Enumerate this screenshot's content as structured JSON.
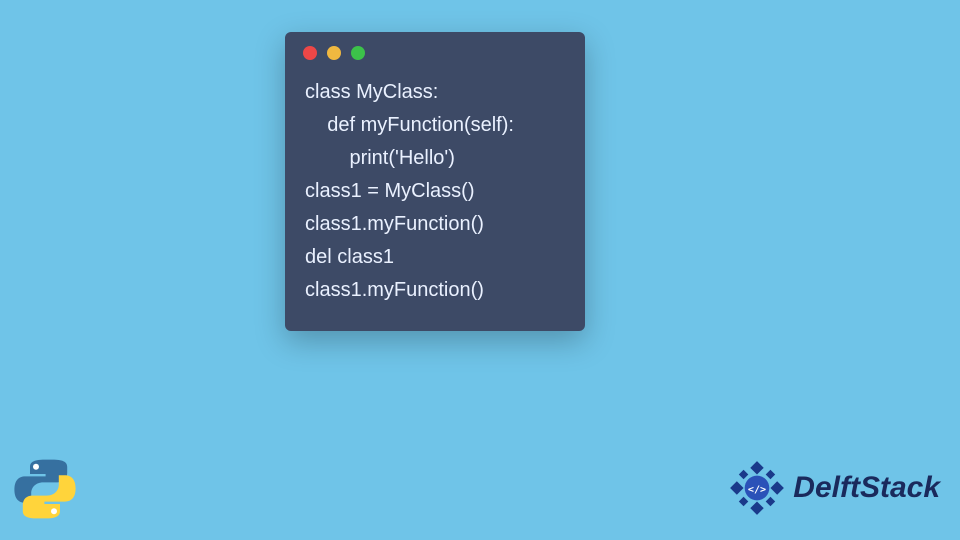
{
  "window": {
    "dots": {
      "red": "#ed4747",
      "yellow": "#f0b840",
      "green": "#3cc24a"
    }
  },
  "code": {
    "line1": "class MyClass:",
    "line2": "    def myFunction(self):",
    "line3": "        print('Hello')",
    "line4": "",
    "line5": "class1 = MyClass()",
    "line6": "class1.myFunction()",
    "line7": "del class1",
    "line8": "class1.myFunction()"
  },
  "brand": {
    "name": "DelftStack"
  }
}
